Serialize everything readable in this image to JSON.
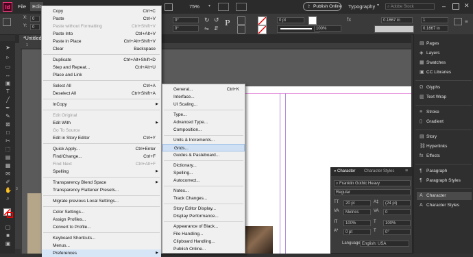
{
  "menubar": {
    "logo": "Id",
    "file": "File",
    "edit": "Edit",
    "zoom": "75%",
    "publish": "Publish Online",
    "workspace": "Typography",
    "search_placeholder": "Adobe Stock"
  },
  "control": {
    "x_label": "X:",
    "y_label": "Y:",
    "x_val": "0",
    "y_val": "0",
    "angle1": "0°",
    "angle2": "0°",
    "stroke_w": "0 pt",
    "pct": "100%",
    "size1": "0.1667 in",
    "size2": "0.1667 in",
    "count": "1"
  },
  "document": {
    "tab": "*Untitled-1",
    "ruler_marks": [
      "1",
      "3"
    ]
  },
  "edit_menu": [
    {
      "label": "Copy",
      "shortcut": "Ctrl+C",
      "state": ""
    },
    {
      "label": "Paste",
      "shortcut": "Ctrl+V",
      "state": ""
    },
    {
      "label": "Paste without Formatting",
      "shortcut": "Ctrl+Shift+V",
      "state": "dis"
    },
    {
      "label": "Paste Into",
      "shortcut": "Ctrl+Alt+V",
      "state": ""
    },
    {
      "label": "Paste in Place",
      "shortcut": "Ctrl+Alt+Shift+V",
      "state": ""
    },
    {
      "label": "Clear",
      "shortcut": "Backspace",
      "state": ""
    },
    {
      "sep": true
    },
    {
      "label": "Duplicate",
      "shortcut": "Ctrl+Alt+Shift+D",
      "state": ""
    },
    {
      "label": "Step and Repeat...",
      "shortcut": "Ctrl+Alt+U",
      "state": ""
    },
    {
      "label": "Place and Link",
      "shortcut": "",
      "state": ""
    },
    {
      "sep": true
    },
    {
      "label": "Select All",
      "shortcut": "Ctrl+A",
      "state": ""
    },
    {
      "label": "Deselect All",
      "shortcut": "Ctrl+Shift+A",
      "state": ""
    },
    {
      "sep": true
    },
    {
      "label": "InCopy",
      "shortcut": "",
      "state": "",
      "sub": true
    },
    {
      "sep": true
    },
    {
      "label": "Edit Original",
      "shortcut": "",
      "state": "dis"
    },
    {
      "label": "Edit With",
      "shortcut": "",
      "state": "",
      "sub": true
    },
    {
      "label": "Go To Source",
      "shortcut": "",
      "state": "dis"
    },
    {
      "label": "Edit in Story Editor",
      "shortcut": "Ctrl+Y",
      "state": ""
    },
    {
      "sep": true
    },
    {
      "label": "Quick Apply...",
      "shortcut": "Ctrl+Enter",
      "state": ""
    },
    {
      "label": "Find/Change...",
      "shortcut": "Ctrl+F",
      "state": ""
    },
    {
      "label": "Find Next",
      "shortcut": "Ctrl+Alt+F",
      "state": "dis"
    },
    {
      "label": "Spelling",
      "shortcut": "",
      "state": "",
      "sub": true
    },
    {
      "sep": true
    },
    {
      "label": "Transparency Blend Space",
      "shortcut": "",
      "state": "",
      "sub": true
    },
    {
      "label": "Transparency Flattener Presets...",
      "shortcut": "",
      "state": ""
    },
    {
      "sep": true
    },
    {
      "label": "Migrate previous Local Settings...",
      "shortcut": "",
      "state": ""
    },
    {
      "sep": true
    },
    {
      "label": "Color Settings...",
      "shortcut": "",
      "state": ""
    },
    {
      "label": "Assign Profiles...",
      "shortcut": "",
      "state": ""
    },
    {
      "label": "Convert to Profile...",
      "shortcut": "",
      "state": ""
    },
    {
      "sep": true
    },
    {
      "label": "Keyboard Shortcuts...",
      "shortcut": "",
      "state": ""
    },
    {
      "label": "Menus...",
      "shortcut": "",
      "state": ""
    },
    {
      "label": "Preferences",
      "shortcut": "",
      "state": "hl",
      "sub": true
    }
  ],
  "prefs_menu": [
    {
      "label": "General...",
      "shortcut": "Ctrl+K"
    },
    {
      "label": "Interface...",
      "shortcut": ""
    },
    {
      "label": "UI Scaling...",
      "shortcut": ""
    },
    {
      "sep": true
    },
    {
      "label": "Type...",
      "shortcut": ""
    },
    {
      "label": "Advanced Type...",
      "shortcut": ""
    },
    {
      "label": "Composition...",
      "shortcut": ""
    },
    {
      "sep": true
    },
    {
      "label": "Units & Increments...",
      "shortcut": ""
    },
    {
      "label": "Grids...",
      "shortcut": "",
      "hl": true
    },
    {
      "label": "Guides & Pasteboard...",
      "shortcut": ""
    },
    {
      "sep": true
    },
    {
      "label": "Dictionary...",
      "shortcut": ""
    },
    {
      "label": "Spelling...",
      "shortcut": ""
    },
    {
      "label": "Autocorrect...",
      "shortcut": ""
    },
    {
      "sep": true
    },
    {
      "label": "Notes...",
      "shortcut": ""
    },
    {
      "label": "Track Changes...",
      "shortcut": ""
    },
    {
      "sep": true
    },
    {
      "label": "Story Editor Display...",
      "shortcut": ""
    },
    {
      "label": "Display Performance...",
      "shortcut": ""
    },
    {
      "sep": true
    },
    {
      "label": "Appearance of Black...",
      "shortcut": ""
    },
    {
      "label": "File Handling...",
      "shortcut": ""
    },
    {
      "label": "Clipboard Handling...",
      "shortcut": ""
    },
    {
      "label": "Publish Online...",
      "shortcut": ""
    }
  ],
  "right_panel": [
    {
      "label": "Pages",
      "icon": "▤"
    },
    {
      "label": "Layers",
      "icon": "◈"
    },
    {
      "label": "Swatches",
      "icon": "▦"
    },
    {
      "label": "CC Libraries",
      "icon": "▣"
    },
    {
      "sep": true
    },
    {
      "label": "Glyphs",
      "icon": "Ω"
    },
    {
      "label": "Text Wrap",
      "icon": "▥"
    },
    {
      "sep": true
    },
    {
      "label": "Stroke",
      "icon": "≡"
    },
    {
      "label": "Gradient",
      "icon": "▯"
    },
    {
      "sep": true
    },
    {
      "label": "Story",
      "icon": "▤"
    },
    {
      "label": "Hyperlinks",
      "icon": "⛓"
    },
    {
      "label": "Effects",
      "icon": "fx"
    },
    {
      "sep": true
    },
    {
      "label": "Paragraph",
      "icon": "¶"
    },
    {
      "label": "Paragraph Styles",
      "icon": "¶"
    },
    {
      "sep": true
    },
    {
      "label": "Character",
      "icon": "A"
    },
    {
      "label": "Character Styles",
      "icon": "A"
    }
  ],
  "character_panel": {
    "tab1": "Character",
    "tab2": "Character Styles",
    "font": "Franklin Gothic Heavy",
    "style": "Regular",
    "size": "20 pt",
    "leading": "(24 pt)",
    "kerning": "Metrics",
    "tracking": "0",
    "vscale": "100%",
    "hscale": "100%",
    "baseline": "0 pt",
    "skew": "0°",
    "language_label": "Language:",
    "language": "English: USA"
  },
  "colors": {
    "accent_pink": "#ff3d7f",
    "menu_bg": "#f0f0f0",
    "app_bg": "#323232"
  }
}
